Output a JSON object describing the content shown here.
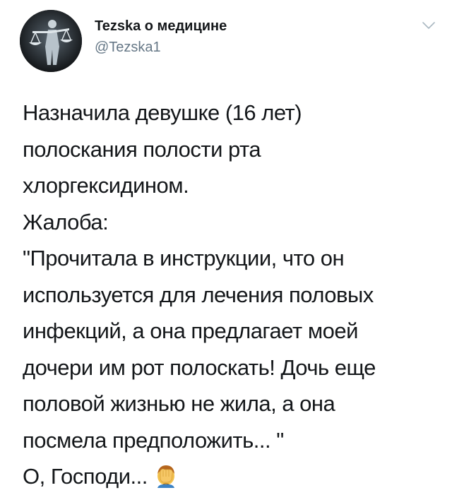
{
  "tweet": {
    "author": {
      "display_name": "Tezska о медицине",
      "handle": "@Tezska1"
    },
    "text_lines": [
      "Назначила девушке (16 лет)",
      "полоскания полости рта",
      "хлоргексидином.",
      "Жалоба:",
      "\"Прочитала в инструкции, что он",
      "используется для лечения половых",
      "инфекций, а она предлагает моей",
      "дочери им рот полоскать! Дочь еще",
      "половой жизнью не жила, а она",
      "посмела предположить... \"",
      "О, Господи..."
    ],
    "emoji": "face-palm-emoji",
    "icons": {
      "menu": "chevron-down-icon",
      "avatar": "libra-figure-avatar"
    },
    "colors": {
      "text": "#14171a",
      "handle": "#657786",
      "chevron": "#aab8c2"
    }
  }
}
